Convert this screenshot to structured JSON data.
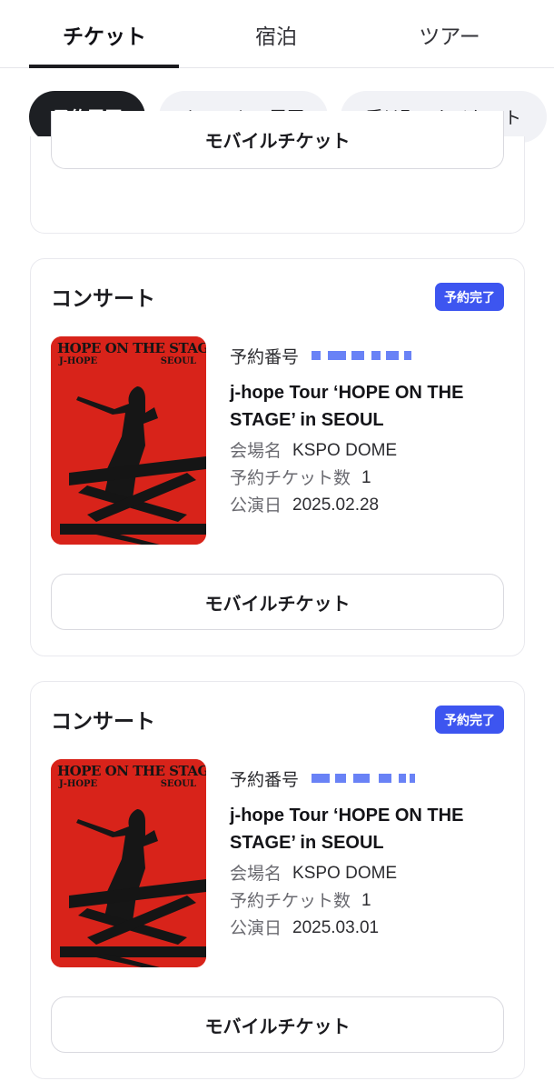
{
  "tabs": [
    {
      "label": "チケット",
      "active": true
    },
    {
      "label": "宿泊",
      "active": false
    },
    {
      "label": "ツアー",
      "active": false
    }
  ],
  "chips": [
    {
      "label": "予約履歴",
      "active": true
    },
    {
      "label": "キャンセル履歴",
      "active": false
    },
    {
      "label": "受け取ったチケット",
      "active": false
    }
  ],
  "partial_card": {
    "button_label": "モバイルチケット"
  },
  "reservations": [
    {
      "category": "コンサート",
      "status": "予約完了",
      "poster": {
        "title": "HOPE ON THE STAGE",
        "artist": "J-HOPE",
        "city": "SEOUL"
      },
      "number_label": "予約番号",
      "event_title": "j-hope Tour ‘HOPE ON THE STAGE’ in SEOUL",
      "venue_label": "会場名",
      "venue": "KSPO DOME",
      "count_label": "予約チケット数",
      "count": "1",
      "date_label": "公演日",
      "date": "2025.02.28",
      "button_label": "モバイルチケット"
    },
    {
      "category": "コンサート",
      "status": "予約完了",
      "poster": {
        "title": "HOPE ON THE STAGE",
        "artist": "J-HOPE",
        "city": "SEOUL"
      },
      "number_label": "予約番号",
      "event_title": "j-hope Tour ‘HOPE ON THE STAGE’ in SEOUL",
      "venue_label": "会場名",
      "venue": "KSPO DOME",
      "count_label": "予約チケット数",
      "count": "1",
      "date_label": "公演日",
      "date": "2025.03.01",
      "button_label": "モバイルチケット"
    }
  ],
  "colors": {
    "accent_badge": "#3d55f0",
    "poster_red": "#d8231a",
    "chip_active": "#1d1f23"
  }
}
